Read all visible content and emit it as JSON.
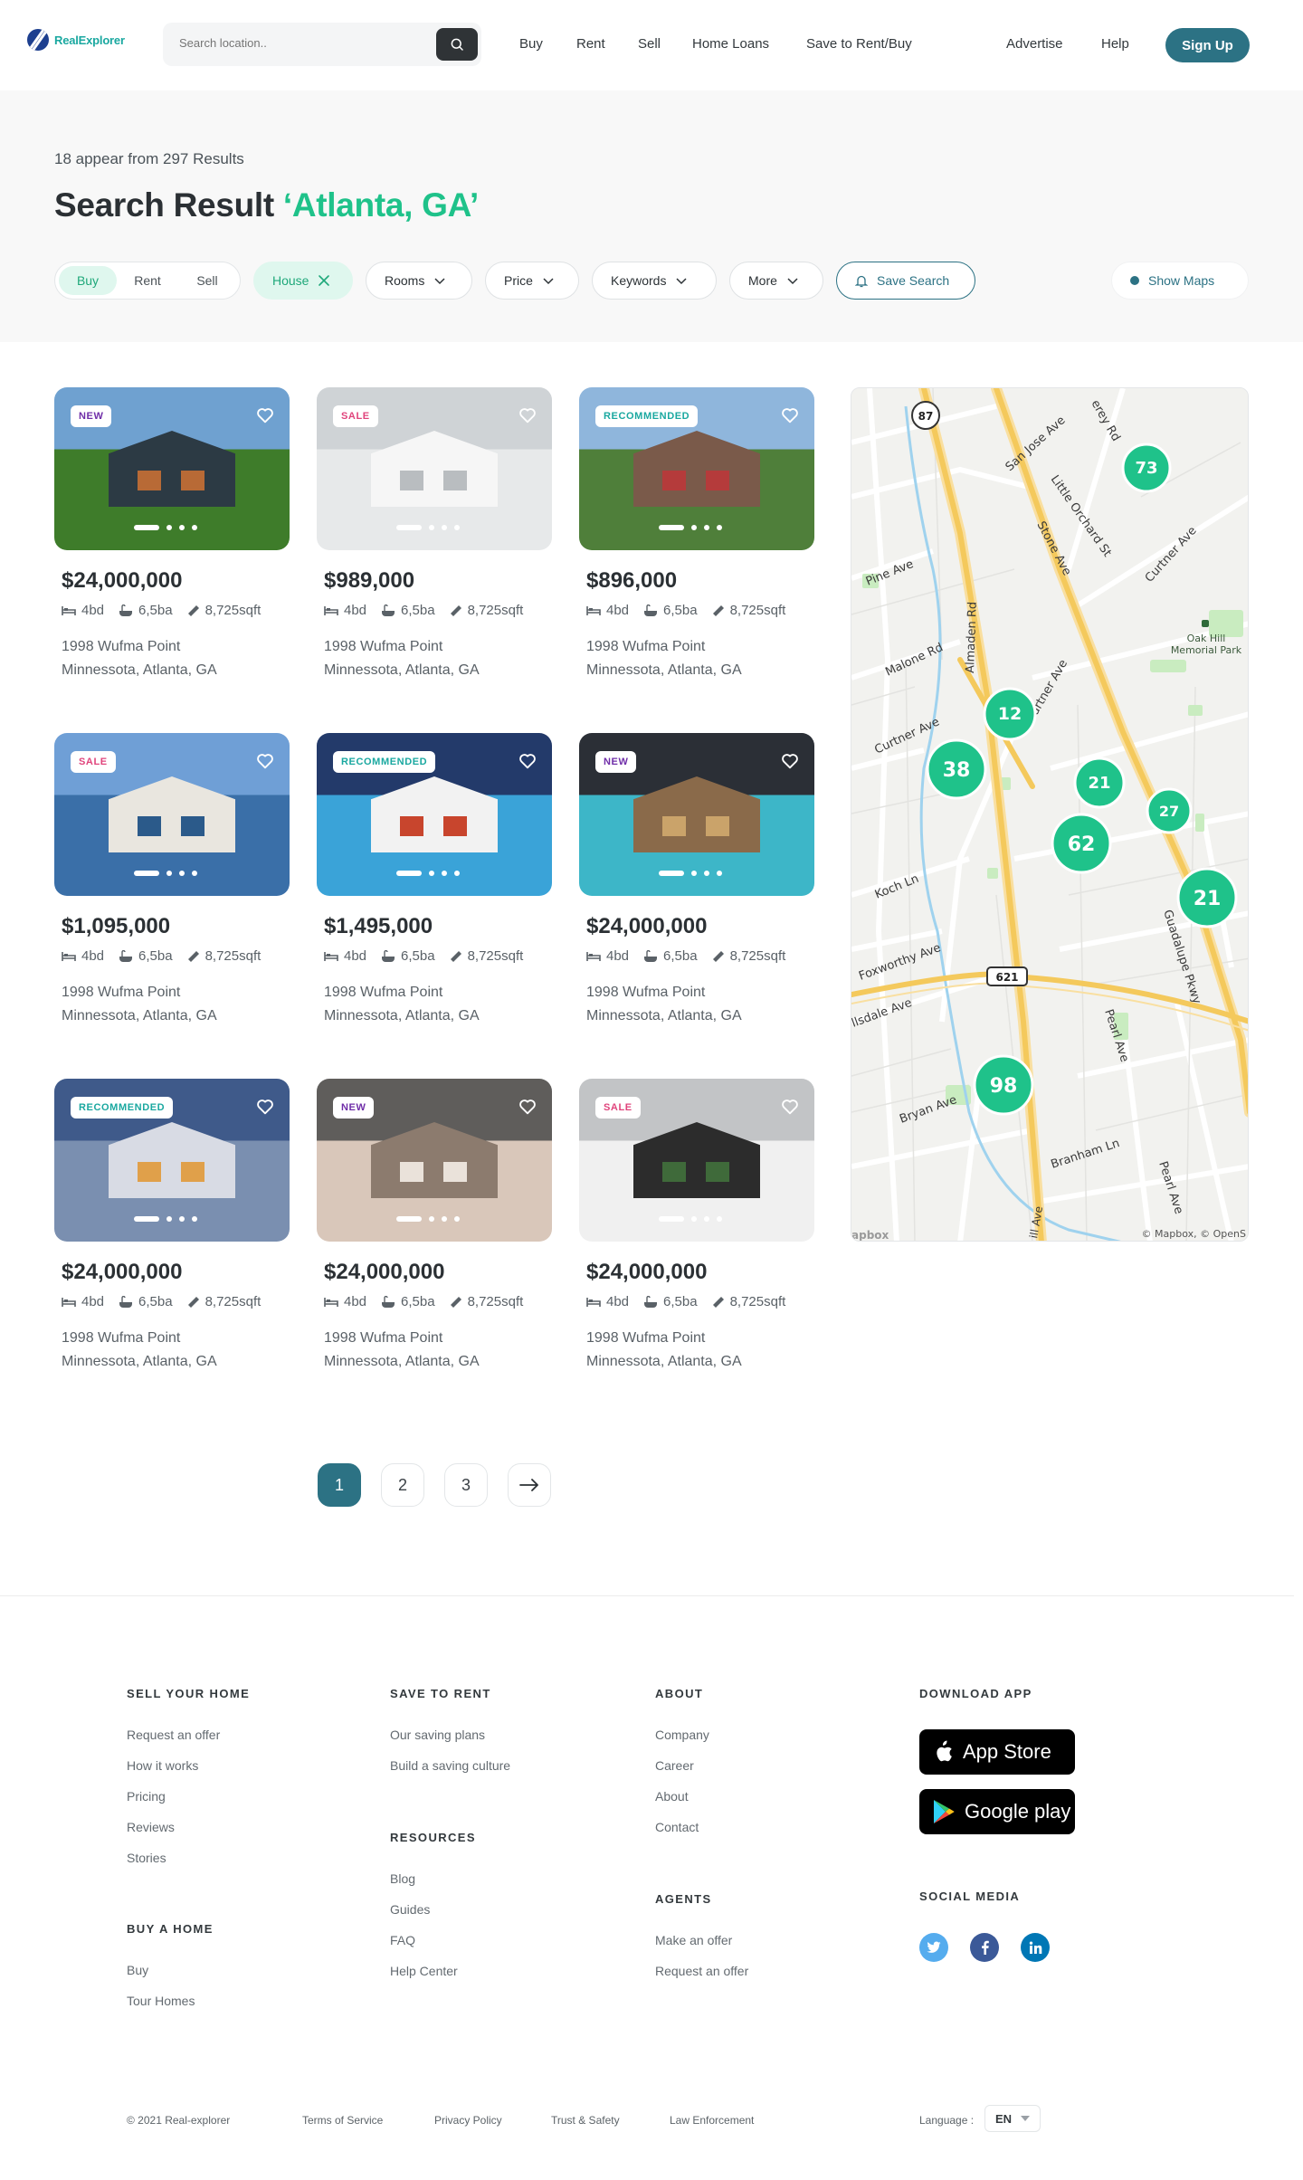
{
  "header": {
    "brand": "RealExplorer",
    "search_placeholder": "Search location..",
    "nav": [
      "Buy",
      "Rent",
      "Sell",
      "Home Loans",
      "Save to Rent/Buy"
    ],
    "nav_right": [
      "Advertise",
      "Help"
    ],
    "signup": "Sign Up",
    "accent": "#2c7284"
  },
  "results": {
    "count_text": "18 appear from 297 Results",
    "title_prefix": "Search Result ",
    "title_location": "‘Atlanta, GA’",
    "segment": [
      "Buy",
      "Rent",
      "Sell"
    ],
    "segment_active": "Buy",
    "type_filter": "House",
    "filters": [
      "Rooms",
      "Price",
      "Keywords",
      "More"
    ],
    "save_search": "Save Search",
    "show_maps": "Show Maps"
  },
  "listings": [
    {
      "badge": "NEW",
      "price": "$24,000,000",
      "beds": "4bd",
      "baths": "6,5ba",
      "sqft": "8,725sqft",
      "street": "1998 Wufma Point",
      "city": "Minnessota, Atlanta, GA"
    },
    {
      "badge": "SALE",
      "price": "$989,000",
      "beds": "4bd",
      "baths": "6,5ba",
      "sqft": "8,725sqft",
      "street": "1998 Wufma Point",
      "city": "Minnessota, Atlanta, GA"
    },
    {
      "badge": "RECOMMENDED",
      "price": "$896,000",
      "beds": "4bd",
      "baths": "6,5ba",
      "sqft": "8,725sqft",
      "street": "1998 Wufma Point",
      "city": "Minnessota, Atlanta, GA"
    },
    {
      "badge": "SALE",
      "price": "$1,095,000",
      "beds": "4bd",
      "baths": "6,5ba",
      "sqft": "8,725sqft",
      "street": "1998 Wufma Point",
      "city": "Minnessota, Atlanta, GA"
    },
    {
      "badge": "RECOMMENDED",
      "price": "$1,495,000",
      "beds": "4bd",
      "baths": "6,5ba",
      "sqft": "8,725sqft",
      "street": "1998 Wufma Point",
      "city": "Minnessota, Atlanta, GA"
    },
    {
      "badge": "NEW",
      "price": "$24,000,000",
      "beds": "4bd",
      "baths": "6,5ba",
      "sqft": "8,725sqft",
      "street": "1998 Wufma Point",
      "city": "Minnessota, Atlanta, GA"
    },
    {
      "badge": "RECOMMENDED",
      "price": "$24,000,000",
      "beds": "4bd",
      "baths": "6,5ba",
      "sqft": "8,725sqft",
      "street": "1998 Wufma Point",
      "city": "Minnessota, Atlanta, GA"
    },
    {
      "badge": "NEW",
      "price": "$24,000,000",
      "beds": "4bd",
      "baths": "6,5ba",
      "sqft": "8,725sqft",
      "street": "1998 Wufma Point",
      "city": "Minnessota, Atlanta, GA"
    },
    {
      "badge": "SALE",
      "price": "$24,000,000",
      "beds": "4bd",
      "baths": "6,5ba",
      "sqft": "8,725sqft",
      "street": "1998 Wufma Point",
      "city": "Minnessota, Atlanta, GA"
    }
  ],
  "map": {
    "clusters": [
      "73",
      "12",
      "38",
      "21",
      "27",
      "62",
      "21",
      "98"
    ],
    "route_shields": [
      "87",
      "621"
    ],
    "streets": [
      "San Jose Ave",
      "Little Orchard St",
      "Stone Ave",
      "Curtner Ave",
      "Pine Ave",
      "Almaden Rd",
      "Malone Rd",
      "Curtner Ave",
      "Curtner Ave",
      "Koch Ln",
      "Foxworthy Ave",
      "llsdale Ave",
      "Guadalupe Pkwy",
      "Pearl Ave",
      "Bryan Ave",
      "Branham Ln",
      "Pearl Ave",
      "Oak Hill Memorial Park",
      "erey Rd"
    ],
    "attribution": "© Mapbox, © OpenS",
    "logo": "apbox"
  },
  "pagination": {
    "pages": [
      "1",
      "2",
      "3"
    ],
    "active": "1",
    "next": "→"
  },
  "footer": {
    "sell": {
      "heading": "SELL YOUR HOME",
      "links": [
        "Request an offer",
        "How it works",
        "Pricing",
        "Reviews",
        "Stories"
      ]
    },
    "buy": {
      "heading": "BUY A HOME",
      "links": [
        "Buy",
        "Tour Homes"
      ]
    },
    "save": {
      "heading": "SAVE TO RENT",
      "links": [
        "Our saving plans",
        "Build a saving culture"
      ]
    },
    "resources": {
      "heading": "RESOURCES",
      "links": [
        "Blog",
        "Guides",
        "FAQ",
        "Help Center"
      ]
    },
    "about": {
      "heading": "ABOUT",
      "links": [
        "Company",
        "Career",
        "About",
        "Contact"
      ]
    },
    "agents": {
      "heading": "AGENTS",
      "links": [
        "Make an offer",
        "Request an offer"
      ]
    },
    "download": {
      "heading": "DOWNLOAD APP",
      "app_store": "App Store",
      "google_play": "Google play"
    },
    "social": {
      "heading": "SOCIAL MEDIA",
      "icons": [
        "twitter-icon",
        "facebook-icon",
        "linkedin-icon"
      ],
      "colors": [
        "#55acee",
        "#3b5998",
        "#0077b5"
      ]
    },
    "bottom": {
      "copyright": "© 2021 Real-explorer",
      "links": [
        "Terms of Service",
        "Privacy Policy",
        "Trust & Safety",
        "Law Enforcement"
      ],
      "language_label": "Language :",
      "language": "EN"
    }
  }
}
